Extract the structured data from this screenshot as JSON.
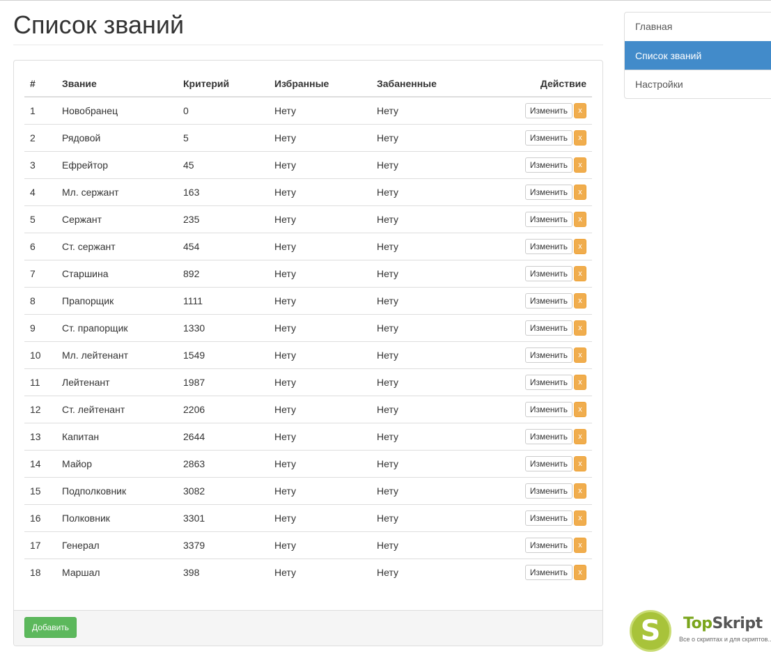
{
  "page": {
    "title": "Список званий"
  },
  "table": {
    "headers": {
      "num": "#",
      "name": "Звание",
      "criterion": "Критерий",
      "favorites": "Избранные",
      "banned": "Забаненные",
      "action": "Действие"
    },
    "edit_label": "Изменить",
    "delete_label": "x",
    "rows": [
      {
        "num": "1",
        "name": "Новобранец",
        "criterion": "0",
        "favorites": "Нету",
        "banned": "Нету"
      },
      {
        "num": "2",
        "name": "Рядовой",
        "criterion": "5",
        "favorites": "Нету",
        "banned": "Нету"
      },
      {
        "num": "3",
        "name": "Ефрейтор",
        "criterion": "45",
        "favorites": "Нету",
        "banned": "Нету"
      },
      {
        "num": "4",
        "name": "Мл. сержант",
        "criterion": "163",
        "favorites": "Нету",
        "banned": "Нету"
      },
      {
        "num": "5",
        "name": "Сержант",
        "criterion": "235",
        "favorites": "Нету",
        "banned": "Нету"
      },
      {
        "num": "6",
        "name": "Ст. сержант",
        "criterion": "454",
        "favorites": "Нету",
        "banned": "Нету"
      },
      {
        "num": "7",
        "name": "Старшина",
        "criterion": "892",
        "favorites": "Нету",
        "banned": "Нету"
      },
      {
        "num": "8",
        "name": "Прапорщик",
        "criterion": "1111",
        "favorites": "Нету",
        "banned": "Нету"
      },
      {
        "num": "9",
        "name": "Ст. прапорщик",
        "criterion": "1330",
        "favorites": "Нету",
        "banned": "Нету"
      },
      {
        "num": "10",
        "name": "Мл. лейтенант",
        "criterion": "1549",
        "favorites": "Нету",
        "banned": "Нету"
      },
      {
        "num": "11",
        "name": "Лейтенант",
        "criterion": "1987",
        "favorites": "Нету",
        "banned": "Нету"
      },
      {
        "num": "12",
        "name": "Ст. лейтенант",
        "criterion": "2206",
        "favorites": "Нету",
        "banned": "Нету"
      },
      {
        "num": "13",
        "name": "Капитан",
        "criterion": "2644",
        "favorites": "Нету",
        "banned": "Нету"
      },
      {
        "num": "14",
        "name": "Майор",
        "criterion": "2863",
        "favorites": "Нету",
        "banned": "Нету"
      },
      {
        "num": "15",
        "name": "Подполковник",
        "criterion": "3082",
        "favorites": "Нету",
        "banned": "Нету"
      },
      {
        "num": "16",
        "name": "Полковник",
        "criterion": "3301",
        "favorites": "Нету",
        "banned": "Нету"
      },
      {
        "num": "17",
        "name": "Генерал",
        "criterion": "3379",
        "favorites": "Нету",
        "banned": "Нету"
      },
      {
        "num": "18",
        "name": "Маршал",
        "criterion": "398",
        "favorites": "Нету",
        "banned": "Нету"
      }
    ]
  },
  "footer": {
    "add_label": "Добавить"
  },
  "sidebar": {
    "items": [
      {
        "label": "Главная",
        "active": false
      },
      {
        "label": "Список званий",
        "active": true
      },
      {
        "label": "Настройки",
        "active": false
      }
    ]
  },
  "brand": {
    "logo_letter": "S",
    "name_part1": "Top",
    "name_part2": "Skript",
    "tagline": "Все о скриптах и для скриптов..."
  },
  "colors": {
    "primary": "#428bca",
    "success": "#5cb85c",
    "warning": "#f0ad4e",
    "brand_green": "#a8c33a"
  }
}
